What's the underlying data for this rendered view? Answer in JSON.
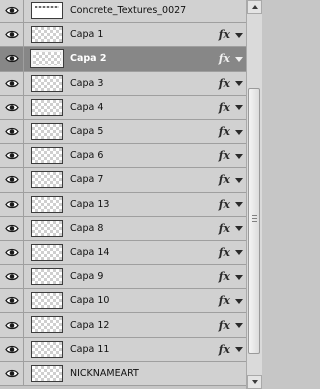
{
  "layers_panel": {
    "layers": [
      {
        "name": "Concrete_Textures_0027",
        "has_fx": false,
        "selected": false,
        "thumbnail": "texture"
      },
      {
        "name": "Capa 1",
        "has_fx": true,
        "selected": false,
        "thumbnail": "transparent"
      },
      {
        "name": "Capa 2",
        "has_fx": true,
        "selected": true,
        "thumbnail": "transparent"
      },
      {
        "name": "Capa 3",
        "has_fx": true,
        "selected": false,
        "thumbnail": "transparent"
      },
      {
        "name": "Capa 4",
        "has_fx": true,
        "selected": false,
        "thumbnail": "transparent"
      },
      {
        "name": "Capa 5",
        "has_fx": true,
        "selected": false,
        "thumbnail": "transparent"
      },
      {
        "name": "Capa 6",
        "has_fx": true,
        "selected": false,
        "thumbnail": "transparent"
      },
      {
        "name": "Capa 7",
        "has_fx": true,
        "selected": false,
        "thumbnail": "transparent"
      },
      {
        "name": "Capa 13",
        "has_fx": true,
        "selected": false,
        "thumbnail": "transparent"
      },
      {
        "name": "Capa 8",
        "has_fx": true,
        "selected": false,
        "thumbnail": "transparent"
      },
      {
        "name": "Capa 14",
        "has_fx": true,
        "selected": false,
        "thumbnail": "transparent"
      },
      {
        "name": "Capa 9",
        "has_fx": true,
        "selected": false,
        "thumbnail": "transparent"
      },
      {
        "name": "Capa 10",
        "has_fx": true,
        "selected": false,
        "thumbnail": "transparent"
      },
      {
        "name": "Capa 12",
        "has_fx": true,
        "selected": false,
        "thumbnail": "transparent"
      },
      {
        "name": "Capa 11",
        "has_fx": true,
        "selected": false,
        "thumbnail": "transparent"
      },
      {
        "name": "NICKNAMEART",
        "has_fx": false,
        "selected": false,
        "thumbnail": "transparent"
      }
    ],
    "fx_symbol": "fx",
    "icons": {
      "visibility": "eye-icon",
      "effects": "fx-icon",
      "expand": "triangle-down-icon"
    },
    "colors": {
      "panel_bg": "#c6c6c6",
      "row_bg": "#d1d1d1",
      "selected_row_bg": "#878787",
      "selected_text": "#ffffff",
      "text": "#101010"
    }
  }
}
